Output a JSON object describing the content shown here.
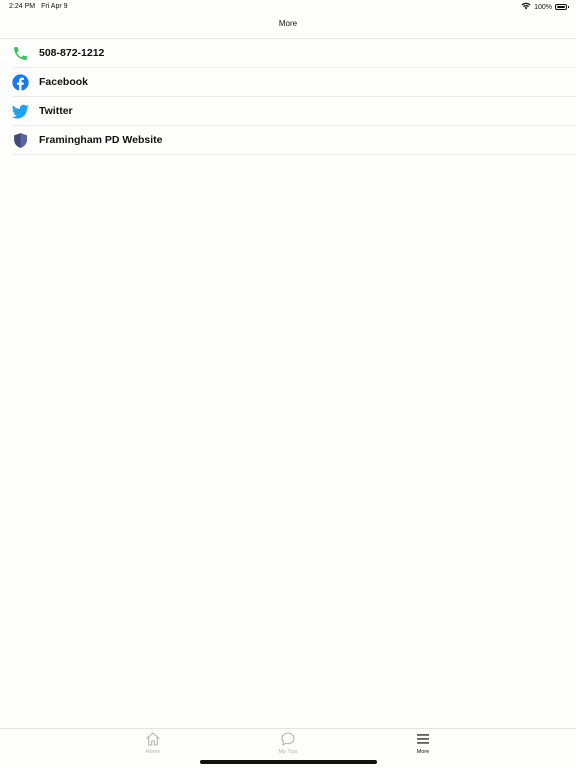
{
  "status_bar": {
    "time": "2:24 PM",
    "date": "Fri Apr 9",
    "battery": "100%"
  },
  "nav": {
    "title": "More"
  },
  "menu": {
    "items": [
      {
        "label": "508-872-1212",
        "icon": "phone-icon"
      },
      {
        "label": "Facebook",
        "icon": "facebook-icon"
      },
      {
        "label": "Twitter",
        "icon": "twitter-icon"
      },
      {
        "label": "Framingham PD Website",
        "icon": "shield-icon"
      }
    ]
  },
  "tabs": [
    {
      "label": "Home",
      "icon": "home-icon"
    },
    {
      "label": "My Tips",
      "icon": "chat-bubble-icon"
    },
    {
      "label": "More",
      "icon": "menu-icon",
      "active": true
    }
  ],
  "colors": {
    "phone": "#34c759",
    "facebook": "#1877f2",
    "twitter": "#1da1f2",
    "shield": "#414a7a",
    "inactive_tab": "#b3b3b3"
  }
}
